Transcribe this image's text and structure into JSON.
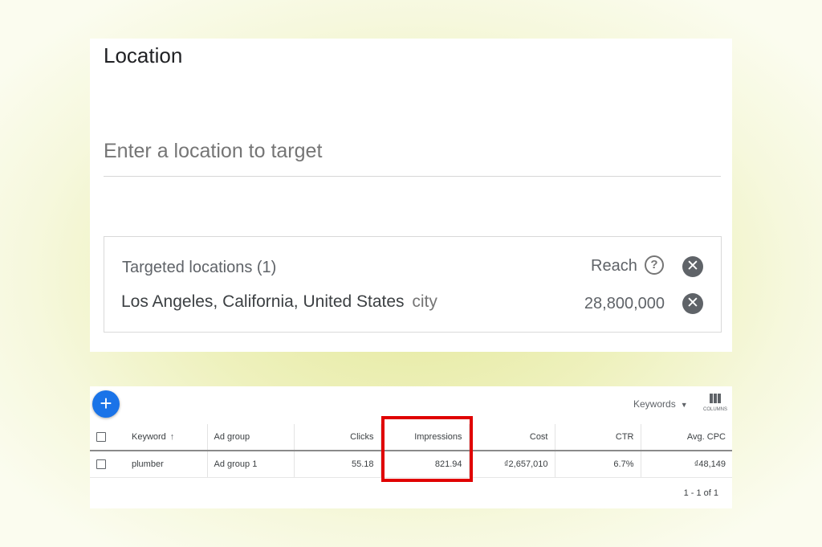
{
  "location": {
    "title": "Location",
    "input_placeholder": "Enter a location to target",
    "targeted_header": "Targeted locations (1)",
    "reach_label": "Reach",
    "help_icon": "?",
    "remove_icon": "✕",
    "items": [
      {
        "name": "Los Angeles, California, United States",
        "type": "city",
        "reach": "28,800,000"
      }
    ]
  },
  "keywords_panel": {
    "add_icon": "+",
    "dropdown_label": "Keywords",
    "columns_label": "COLUMNS",
    "columns_header": [
      "Keyword",
      "Ad group",
      "Clicks",
      "Impressions",
      "Cost",
      "CTR",
      "Avg. CPC"
    ],
    "sort_icon": "↑",
    "rows": [
      {
        "keyword": "plumber",
        "ad_group": "Ad group 1",
        "clicks": "55.18",
        "impressions": "821.94",
        "cost": "₫2,657,010",
        "ctr": "6.7%",
        "avg_cpc": "₫48,149"
      }
    ],
    "pagination": "1 - 1 of 1"
  },
  "colors": {
    "accent": "#1a73e8",
    "highlight": "#e00000"
  }
}
